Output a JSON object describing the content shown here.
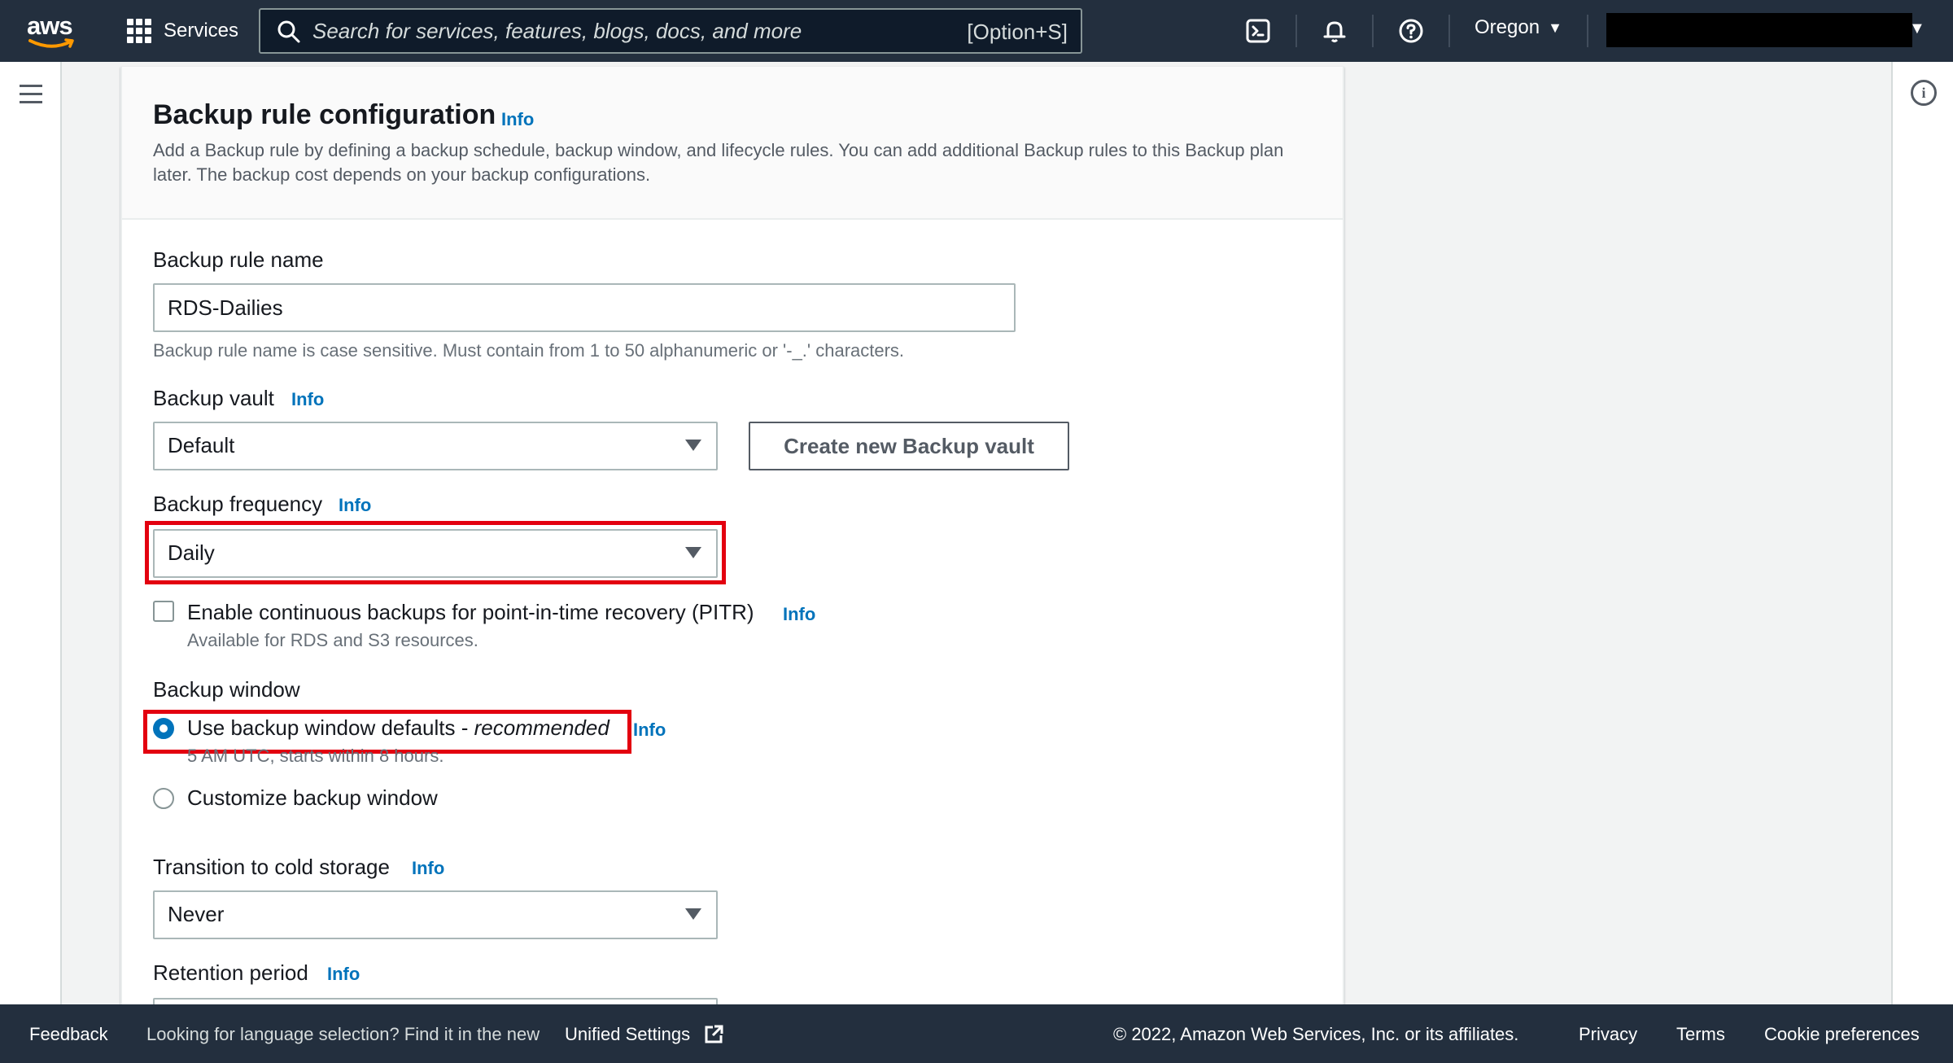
{
  "nav": {
    "logo_text": "aws",
    "services_label": "Services",
    "search_placeholder": "Search for services, features, blogs, docs, and more",
    "search_shortcut": "[Option+S]",
    "region_label": "Oregon"
  },
  "card": {
    "title": "Backup rule configuration",
    "title_info": "Info",
    "description": "Add a Backup rule by defining a backup schedule, backup window, and lifecycle rules. You can add additional Backup rules to this Backup plan later. The backup cost depends on your backup configurations."
  },
  "form": {
    "rule_name_label": "Backup rule name",
    "rule_name_value": "RDS-Dailies",
    "rule_name_hint": "Backup rule name is case sensitive. Must contain from 1 to 50 alphanumeric or '-_.' characters.",
    "vault_label": "Backup vault",
    "vault_info": "Info",
    "vault_value": "Default",
    "create_vault_button": "Create new Backup vault",
    "frequency_label": "Backup frequency",
    "frequency_info": "Info",
    "frequency_value": "Daily",
    "pitr_label": "Enable continuous backups for point-in-time recovery (PITR)",
    "pitr_info": "Info",
    "pitr_checked": false,
    "pitr_hint": "Available for RDS and S3 resources.",
    "window_label": "Backup window",
    "window_default_label": "Use backup window defaults - ",
    "window_default_emph": "recommended",
    "window_default_info": "Info",
    "window_default_hint": "5 AM UTC, starts within 8 hours.",
    "window_default_selected": true,
    "window_custom_label": "Customize backup window",
    "cold_label": "Transition to cold storage",
    "cold_info": "Info",
    "cold_value": "Never",
    "retention_label": "Retention period",
    "retention_info": "Info"
  },
  "footer": {
    "feedback": "Feedback",
    "language_text": "Looking for language selection? Find it in the new",
    "unified_settings": "Unified Settings",
    "copyright": "© 2022, Amazon Web Services, Inc. or its affiliates.",
    "privacy": "Privacy",
    "terms": "Terms",
    "cookie": "Cookie preferences"
  },
  "colors": {
    "nav_bg": "#232f3e",
    "link": "#0073bb",
    "highlight": "#e3000f"
  }
}
